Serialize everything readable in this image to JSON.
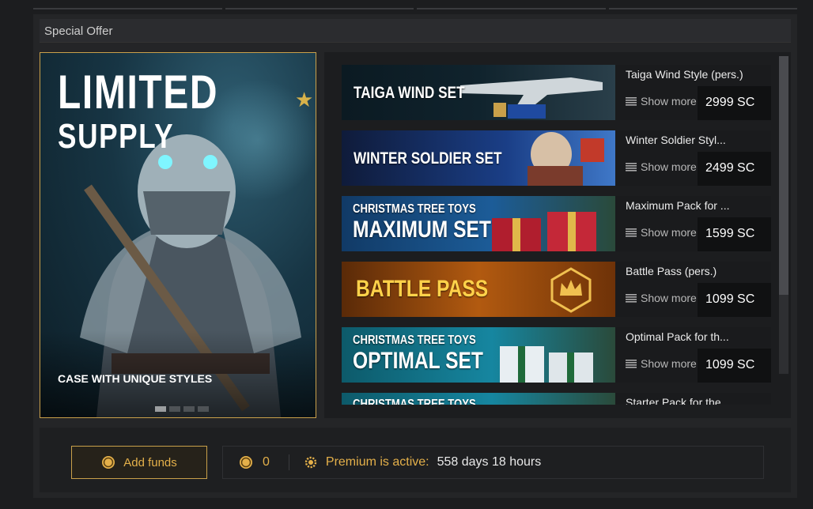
{
  "panel": {
    "title": "Special Offer"
  },
  "featured": {
    "title_line1": "LIMITED",
    "title_line2": "SUPPLY",
    "caption": "CASE WITH UNIQUE STYLES",
    "slides": 4,
    "active_slide": 1
  },
  "offers": [
    {
      "banner_small": "",
      "banner_big": "TAIGA WIND SET",
      "name": "Taiga Wind Style (pers.)",
      "more": "Show more",
      "price": "2999 SC"
    },
    {
      "banner_small": "",
      "banner_big": "WINTER SOLDIER SET",
      "name": "Winter Soldier Styl...",
      "more": "Show more",
      "price": "2499 SC"
    },
    {
      "banner_small": "CHRISTMAS TREE TOYS",
      "banner_big": "MAXIMUM SET",
      "name": "Maximum Pack for ...",
      "more": "Show more",
      "price": "1599 SC"
    },
    {
      "banner_small": "",
      "banner_big": "BATTLE PASS",
      "name": "Battle Pass (pers.)",
      "more": "Show more",
      "price": "1099 SC"
    },
    {
      "banner_small": "CHRISTMAS TREE TOYS",
      "banner_big": "OPTIMAL SET",
      "name": "Optimal Pack for th...",
      "more": "Show more",
      "price": "1099 SC"
    },
    {
      "banner_small": "CHRISTMAS TREE TOYS",
      "banner_big": "",
      "name": "Starter Pack for the",
      "more": "",
      "price": ""
    }
  ],
  "footer": {
    "add_funds": "Add funds",
    "balance": "0",
    "premium_label": "Premium is active:",
    "premium_time": "558 days 18 hours"
  },
  "colors": {
    "accent_gold": "#e4b04a",
    "border_gold": "#c9a04a",
    "panel_bg": "#242527"
  }
}
